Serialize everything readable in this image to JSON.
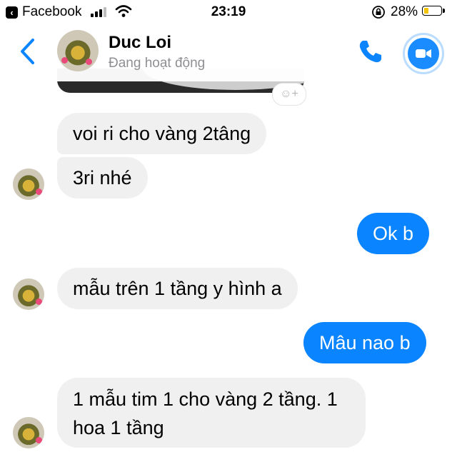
{
  "status_bar": {
    "back_app": "Facebook",
    "time": "23:19",
    "battery_pct": "28%",
    "battery_level": 0.28,
    "battery_color": "#f5c400"
  },
  "header": {
    "name": "Duc Loi",
    "status": "Đang hoạt động",
    "accent": "#0a84ff"
  },
  "messages": [
    {
      "dir": "in",
      "text": "voi ri cho vàng 2tâng"
    },
    {
      "dir": "in",
      "text": "3ri nhé"
    },
    {
      "dir": "out",
      "text": "Ok b"
    },
    {
      "dir": "in",
      "text": "mẫu trên 1 tầng y hình a"
    },
    {
      "dir": "out",
      "text": "Mâu nao b"
    },
    {
      "dir": "in",
      "text": "1 mẫu tim 1 cho vàng 2 tầng. 1 hoa 1 tầng"
    }
  ],
  "icons": [
    "back-chevron-icon",
    "phone-icon",
    "video-camera-icon",
    "add-reaction-icon",
    "wifi-icon",
    "lock-rotation-icon",
    "signal-icon",
    "battery-icon"
  ]
}
